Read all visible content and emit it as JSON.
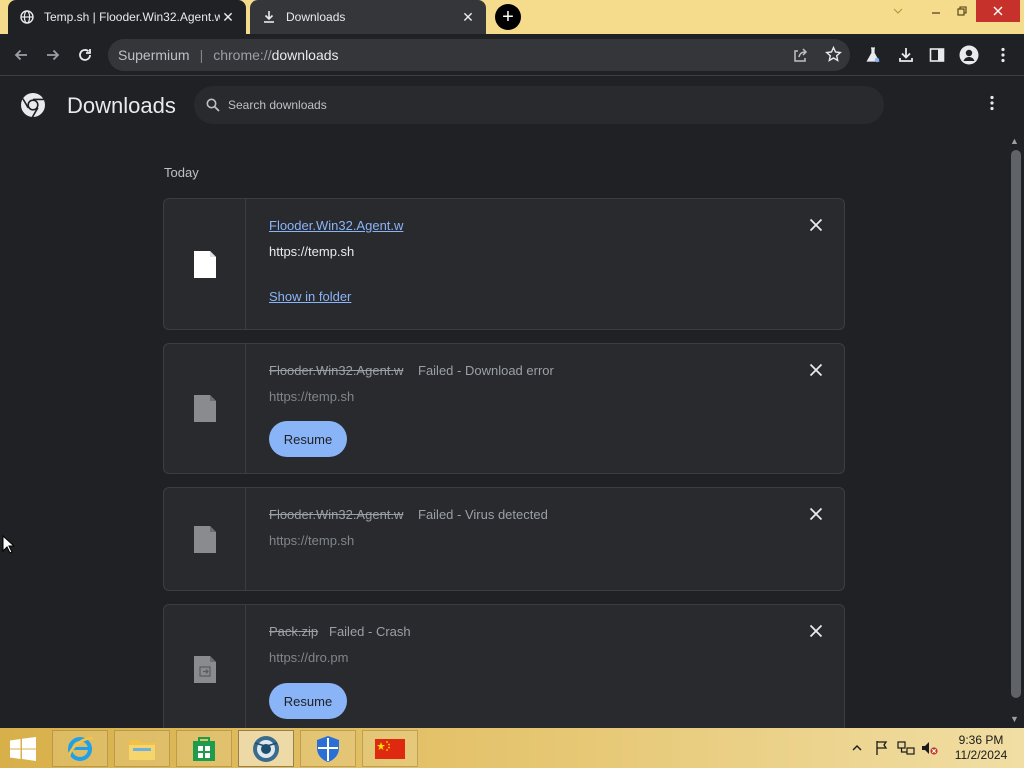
{
  "browser": {
    "tabs": [
      {
        "title": "Temp.sh | Flooder.Win32.Agent.w",
        "active": true
      },
      {
        "title": "Downloads",
        "active": false
      }
    ],
    "omnibox": {
      "label": "Supermium",
      "separator": "|",
      "url_scheme": "chrome://",
      "url_host": "downloads"
    },
    "accent_color": "#f4dc8c"
  },
  "downloads_page": {
    "title": "Downloads",
    "search_placeholder": "Search downloads",
    "section_label": "Today",
    "items": [
      {
        "filename": "Flooder.Win32.Agent.w",
        "status": "",
        "source": "https://temp.sh",
        "action_link": "Show in folder",
        "failed": false,
        "icon": "blank-file-icon"
      },
      {
        "filename": "Flooder.Win32.Agent.w",
        "status": "Failed - Download error",
        "source": "https://temp.sh",
        "button": "Resume",
        "failed": true,
        "icon": "generic-file-icon"
      },
      {
        "filename": "Flooder.Win32.Agent.w",
        "status": "Failed - Virus detected",
        "source": "https://temp.sh",
        "failed": true,
        "icon": "generic-file-icon"
      },
      {
        "filename": "Pack.zip",
        "status": "Failed - Crash",
        "source": "https://dro.pm",
        "button": "Resume",
        "failed": true,
        "icon": "archive-file-icon"
      }
    ]
  },
  "taskbar": {
    "apps": [
      "Internet Explorer",
      "File Explorer",
      "Store",
      "Supermium",
      "Windows Defender",
      "Flag app"
    ],
    "clock_time": "9:36 PM",
    "clock_date": "11/2/2024"
  }
}
